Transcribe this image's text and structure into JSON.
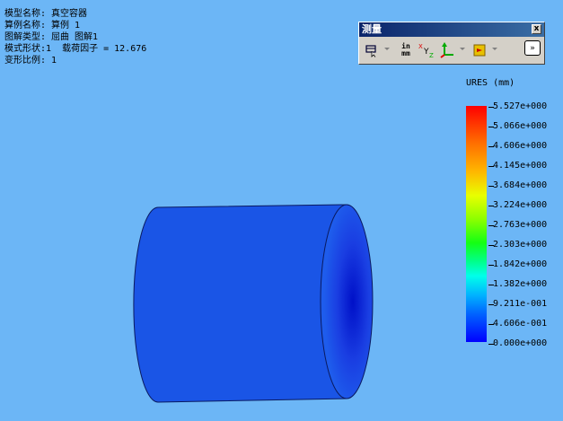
{
  "info": {
    "lines": [
      "模型名称: 真空容器",
      "算例名称: 算例 1",
      "图解类型: 屈曲 图解1",
      "模式形状:1  载荷因子 = 12.676",
      "变形比例: 1"
    ]
  },
  "panel": {
    "title": "测量",
    "close_label": "x",
    "units_top": "in",
    "units_bottom": "mm",
    "expand_label": "»"
  },
  "legend": {
    "title": "URES (mm)",
    "labels": [
      "5.527e+000",
      "5.066e+000",
      "4.606e+000",
      "4.145e+000",
      "3.684e+000",
      "3.224e+000",
      "2.763e+000",
      "2.303e+000",
      "1.842e+000",
      "1.382e+000",
      "9.211e-001",
      "4.606e-001",
      "0.000e+000"
    ]
  },
  "colors": {
    "background": "#6cb6f6",
    "cylinder": "#1a55e6",
    "cylinder_inner": "#0a1fd8"
  }
}
